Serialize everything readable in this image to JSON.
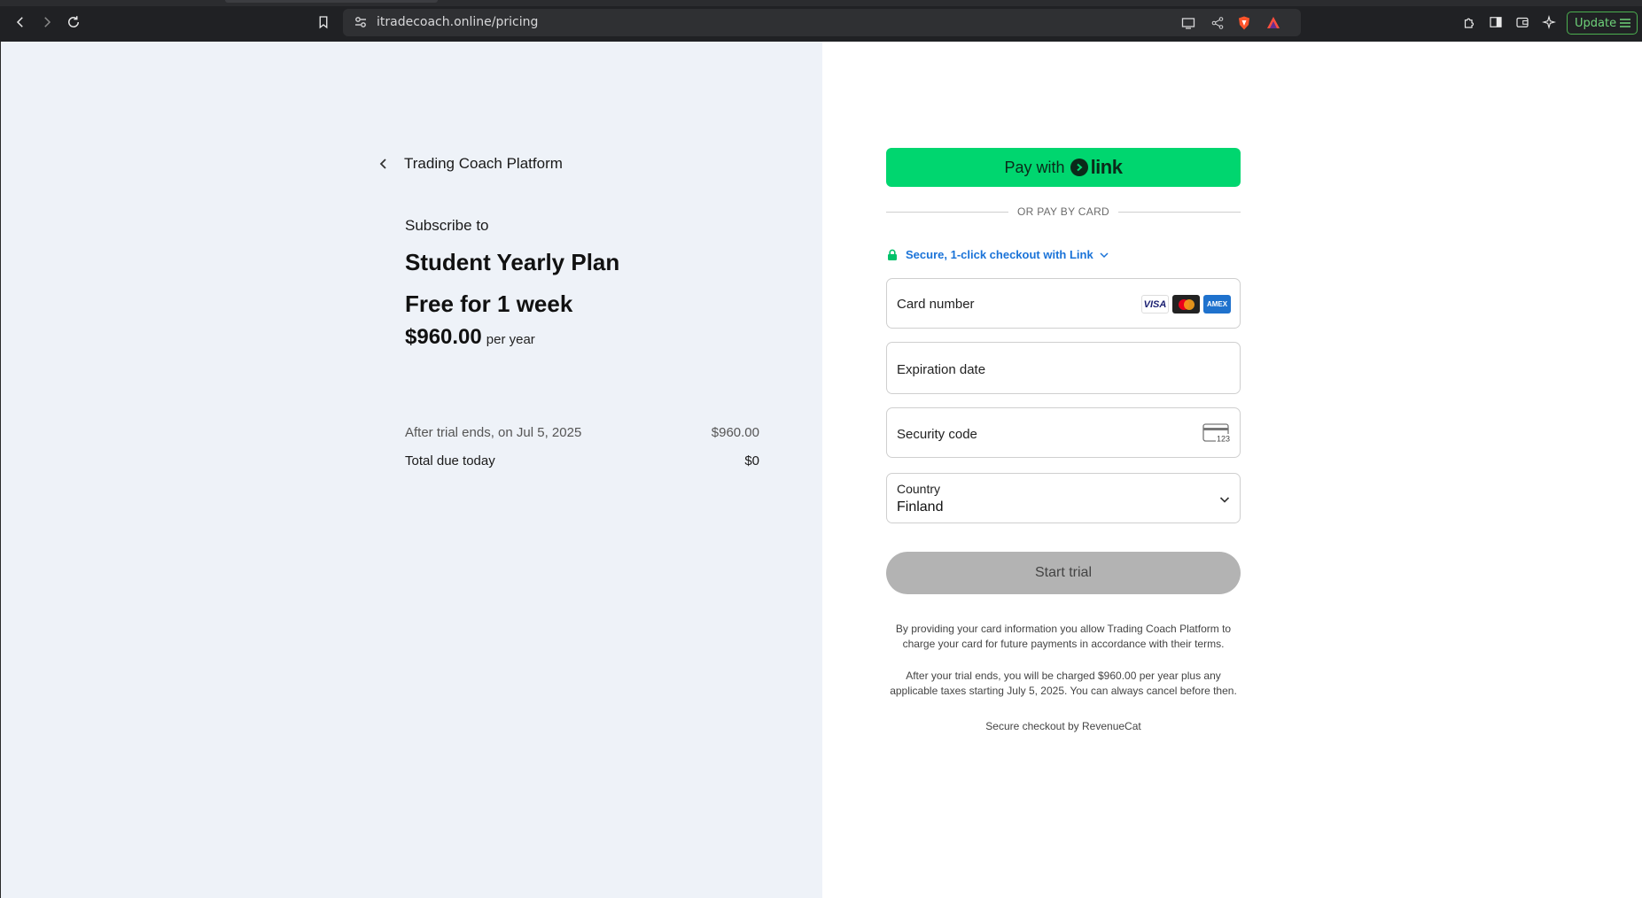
{
  "browser": {
    "url": "itradecoach.online/pricing",
    "update_label": "Update"
  },
  "merchant": {
    "name": "Trading Coach Platform"
  },
  "summary": {
    "subscribe_to": "Subscribe to",
    "plan_name": "Student Yearly Plan",
    "trial": "Free for 1 week",
    "price": "$960.00",
    "period": "per year",
    "rows": [
      {
        "label": "After trial ends, on Jul 5, 2025",
        "value": "$960.00"
      },
      {
        "label": "Total due today",
        "value": "$0"
      }
    ]
  },
  "payment": {
    "pay_with_label": "Pay with",
    "link_word": "link",
    "divider_text": "OR PAY BY CARD",
    "secure_link_text": "Secure, 1-click checkout with Link",
    "card_number_label": "Card number",
    "card_brands": [
      "VISA",
      "mastercard",
      "AMEX"
    ],
    "expiration_label": "Expiration date",
    "security_code_label": "Security code",
    "cvc_hint": "123",
    "country_label": "Country",
    "country_value": "Finland",
    "submit_label": "Start trial",
    "disclaimer": "By providing your card information you allow Trading Coach Platform to charge your card for future payments in accordance with their terms.",
    "trial_notice": "After your trial ends, you will be charged $960.00 per year plus any applicable taxes starting July 5, 2025. You can always cancel before then.",
    "powered_by": "Secure checkout by RevenueCat"
  },
  "colors": {
    "link_green": "#00d66f",
    "link_blue": "#1a73d8",
    "left_bg": "#eef2f8",
    "button_disabled": "#b3b3b3"
  }
}
